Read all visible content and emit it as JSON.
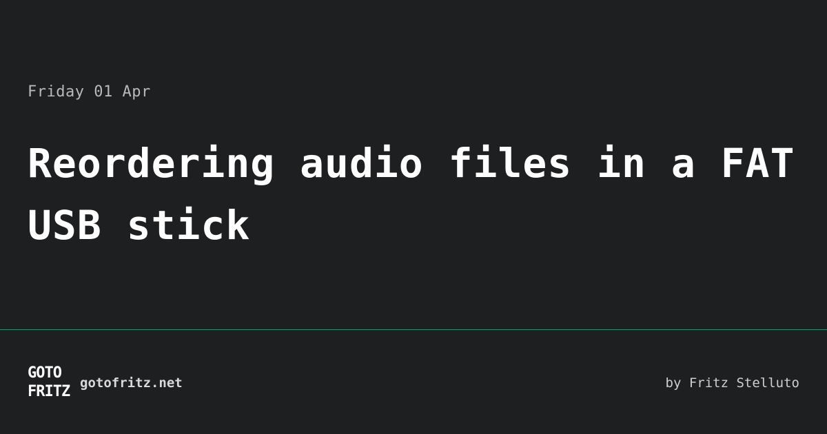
{
  "post": {
    "date": "Friday 01 Apr",
    "title": "Reordering audio files in a FAT USB stick"
  },
  "footer": {
    "logo_line1": "GOTO",
    "logo_line2": "FRITZ",
    "site": "gotofritz.net",
    "byline": "by Fritz Stelluto"
  },
  "colors": {
    "background": "#1e1f21",
    "divider": "#2f8f6b",
    "text": "#ffffff",
    "muted_text": "#b9b9b9"
  }
}
